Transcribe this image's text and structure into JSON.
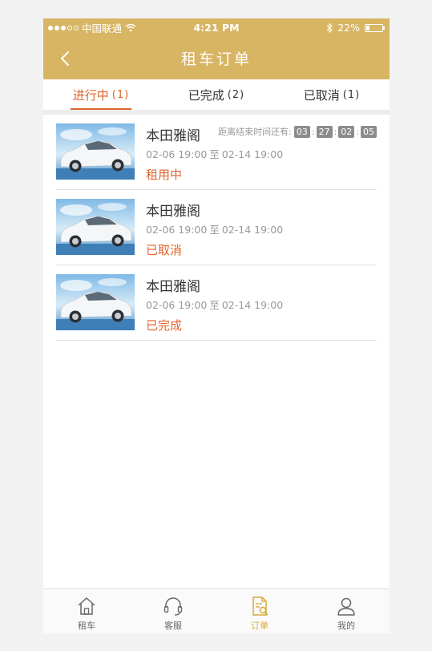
{
  "status_bar": {
    "carrier": "中国联通",
    "time": "4:21 PM",
    "battery": "22%",
    "battery_level": 0.22
  },
  "navbar": {
    "title": "租车订单"
  },
  "tabs": [
    {
      "label": "进行中",
      "count": "(1)",
      "active": true
    },
    {
      "label": "已完成",
      "count": "(2)",
      "active": false
    },
    {
      "label": "已取消",
      "count": "(1)",
      "active": false
    }
  ],
  "orders": [
    {
      "name": "本田雅阁",
      "start": "02-06 19:00",
      "sep": "至",
      "end": "02-14 19:00",
      "status": "租用中",
      "countdown": {
        "label": "距离结束时间还有:",
        "d": "03",
        "h": "27",
        "m": "02",
        "s": "05"
      }
    },
    {
      "name": "本田雅阁",
      "start": "02-06 19:00",
      "sep": "至",
      "end": "02-14 19:00",
      "status": "已取消"
    },
    {
      "name": "本田雅阁",
      "start": "02-06 19:00",
      "sep": "至",
      "end": "02-14 19:00",
      "status": "已完成"
    }
  ],
  "tabbar": [
    {
      "label": "租车",
      "icon": "home-icon"
    },
    {
      "label": "客服",
      "icon": "headset-icon"
    },
    {
      "label": "订单",
      "icon": "order-search-icon",
      "active": true
    },
    {
      "label": "我的",
      "icon": "user-icon"
    }
  ],
  "colors": {
    "accent": "#d8b563",
    "highlight": "#e0622c",
    "tab_active": "#d8a935"
  }
}
